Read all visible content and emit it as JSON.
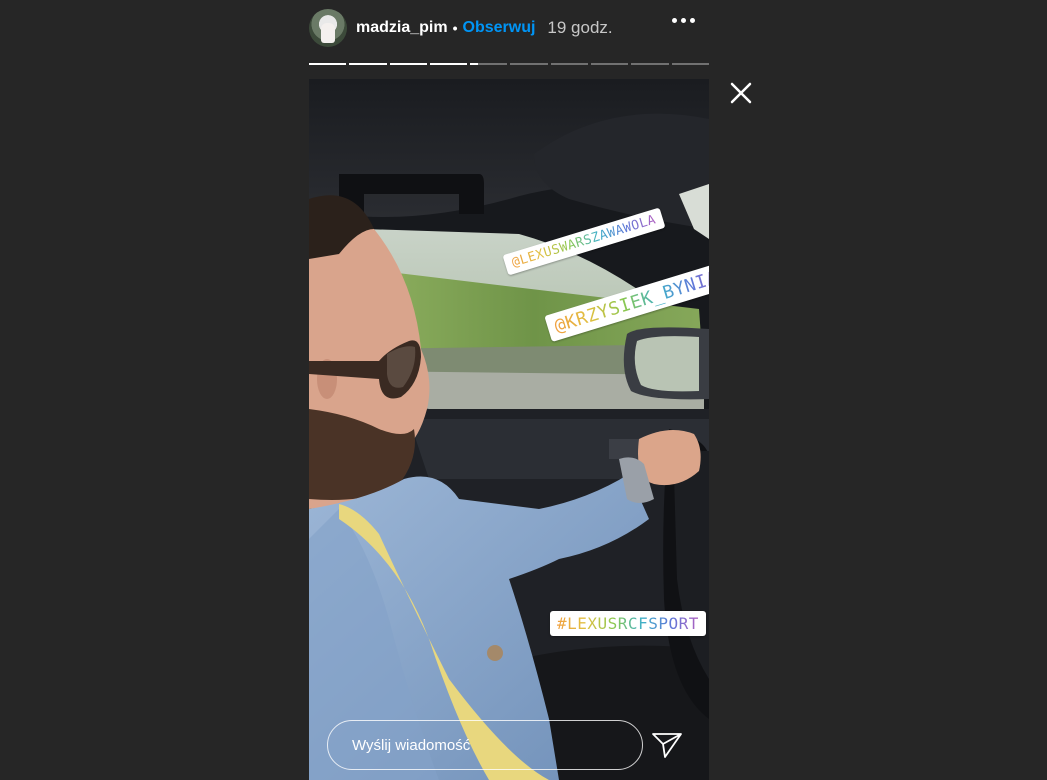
{
  "header": {
    "username": "madzia_pim",
    "separator": "•",
    "follow_label": "Obserwuj",
    "timestamp": "19 godz.",
    "more_icon": "more-horizontal-icon",
    "avatar_icon": "avatar"
  },
  "progress": {
    "segments": 10,
    "current_index": 4,
    "current_fraction": 0.2
  },
  "close_icon": "close-icon",
  "stickers": {
    "mention1": "@LEXUSWARSZAWAWOLA",
    "mention2": "@KRZYSIEK_BYNIAK",
    "hashtag": "#LEXUSRCFSPORT"
  },
  "reply": {
    "placeholder": "Wyślij wiadomość",
    "send_icon": "send-icon"
  },
  "colors": {
    "background": "#262626",
    "follow": "#0095f6",
    "progress_done": "#ffffff"
  }
}
